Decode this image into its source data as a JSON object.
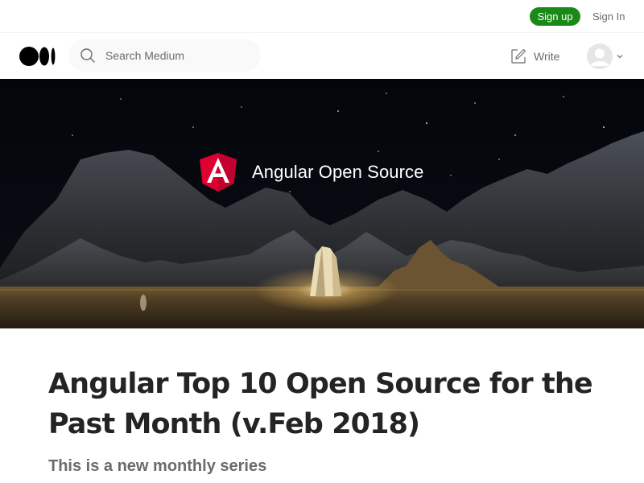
{
  "topbar": {
    "signup_label": "Sign up",
    "signin_label": "Sign In"
  },
  "nav": {
    "search_placeholder": "Search Medium",
    "write_label": "Write"
  },
  "hero": {
    "brand_text": "Angular Open Source",
    "logo_letter": "A"
  },
  "article": {
    "title": "Angular Top 10 Open Source for the Past Month (v.Feb 2018)",
    "subtitle": "This is a new monthly series"
  },
  "colors": {
    "signup_bg": "#1a8917",
    "angular_red": "#dd0031",
    "text_primary": "#242424",
    "text_secondary": "#6b6b6b"
  }
}
